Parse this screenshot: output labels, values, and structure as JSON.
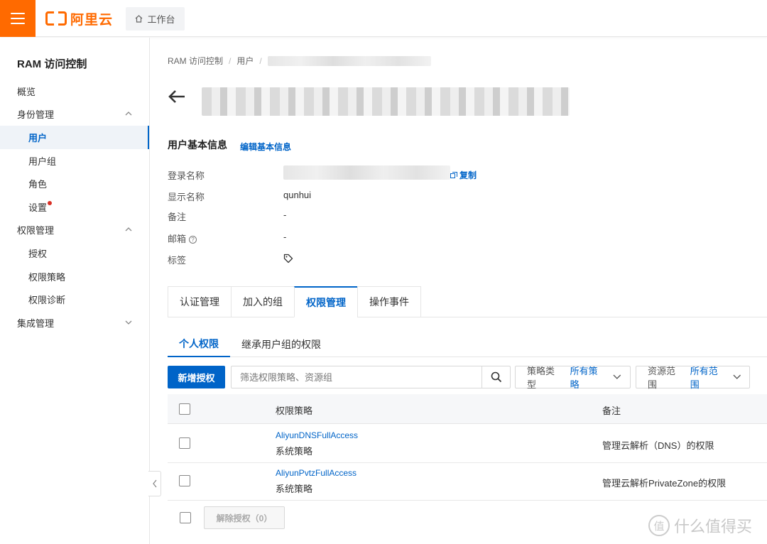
{
  "brand": {
    "name": "阿里云",
    "color": "#ff6a00"
  },
  "topbar": {
    "workbench_label": "工作台"
  },
  "sidebar": {
    "title": "RAM 访问控制",
    "items": [
      {
        "label": "概览",
        "level": 1
      },
      {
        "label": "身份管理",
        "level": 1,
        "expanded": true
      },
      {
        "label": "用户",
        "level": 2,
        "active": true
      },
      {
        "label": "用户组",
        "level": 2
      },
      {
        "label": "角色",
        "level": 2
      },
      {
        "label": "设置",
        "level": 2,
        "badge": "red-dot"
      },
      {
        "label": "权限管理",
        "level": 1,
        "expanded": true
      },
      {
        "label": "授权",
        "level": 2
      },
      {
        "label": "权限策略",
        "level": 2
      },
      {
        "label": "权限诊断",
        "level": 2
      },
      {
        "label": "集成管理",
        "level": 1,
        "expanded": false
      }
    ]
  },
  "breadcrumb": {
    "items": [
      "RAM 访问控制",
      "用户"
    ]
  },
  "user_info": {
    "section_title": "用户基本信息",
    "edit_label": "编辑基本信息",
    "copy_label": "复制",
    "fields": [
      {
        "label": "登录名称",
        "value": ""
      },
      {
        "label": "显示名称",
        "value": "qunhui"
      },
      {
        "label": "备注",
        "value": "-"
      },
      {
        "label": "邮箱",
        "value": "-"
      },
      {
        "label": "标签",
        "value": ""
      }
    ]
  },
  "tabs": [
    {
      "label": "认证管理"
    },
    {
      "label": "加入的组"
    },
    {
      "label": "权限管理",
      "active": true
    },
    {
      "label": "操作事件"
    }
  ],
  "subtabs": [
    {
      "label": "个人权限",
      "active": true
    },
    {
      "label": "继承用户组的权限"
    }
  ],
  "toolbar": {
    "add_label": "新增授权",
    "search_placeholder": "筛选权限策略、资源组",
    "policy_type": {
      "label": "策略类型",
      "value": "所有策略"
    },
    "resource_scope": {
      "label": "资源范围",
      "value": "所有范围"
    }
  },
  "table": {
    "headers": {
      "policy": "权限策略",
      "note": "备注"
    },
    "rows": [
      {
        "policy": "AliyunDNSFullAccess",
        "type": "系统策略",
        "note": "管理云解析（DNS）的权限"
      },
      {
        "policy": "AliyunPvtzFullAccess",
        "type": "系统策略",
        "note": "管理云解析PrivateZone的权限"
      }
    ],
    "revoke_label": "解除授权（0）"
  },
  "watermark": {
    "text": "什么值得买",
    "mark": "值"
  },
  "colors": {
    "primary": "#0064c8",
    "accent": "#ff6a00",
    "badge": "#d93026"
  }
}
